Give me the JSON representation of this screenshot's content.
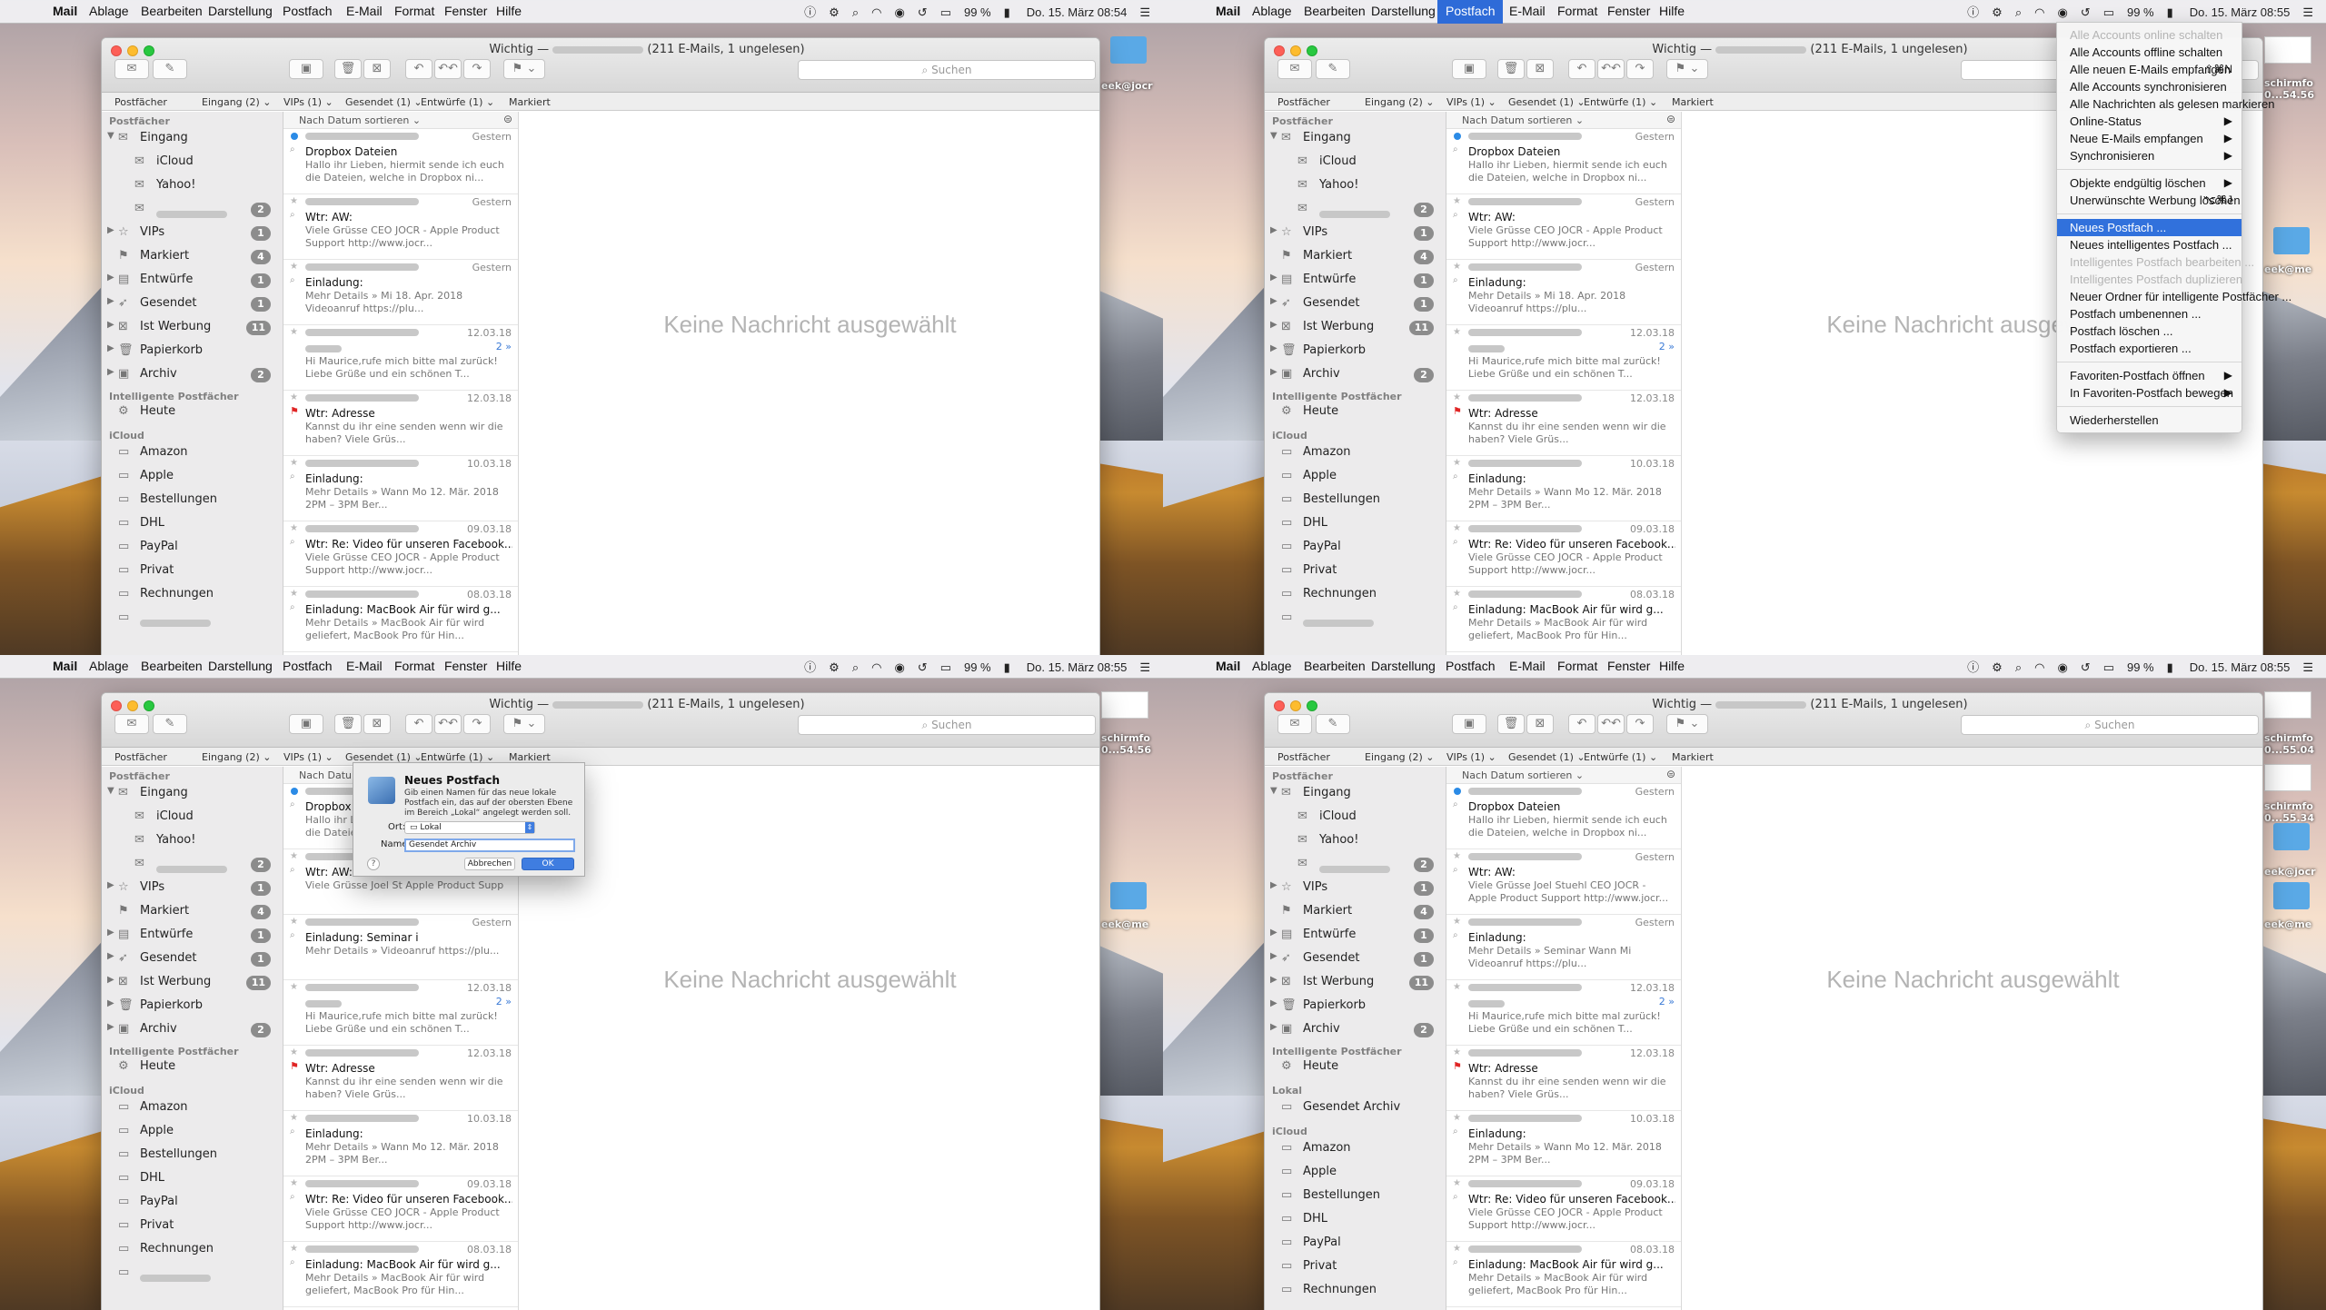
{
  "menubar": {
    "apple": "",
    "items": [
      "Mail",
      "Ablage",
      "Bearbeiten",
      "Darstellung",
      "Postfach",
      "E-Mail",
      "Format",
      "Fenster",
      "Hilfe"
    ],
    "battery": "99 %",
    "times": [
      "Do. 15. März 08:54",
      "Do. 15. März 08:55",
      "Do. 15. März 08:55",
      "Do. 15. März 08:55"
    ]
  },
  "window": {
    "title_prefix": "Wichtig —",
    "title_suffix": "(211 E-Mails, 1 ungelesen)",
    "search_placeholder": "Suchen"
  },
  "favorites": [
    "Postfächer",
    "Eingang (2) ⌄",
    "VIPs (1) ⌄",
    "Gesendet (1) ⌄",
    "Entwürfe (1) ⌄",
    "Markiert"
  ],
  "sidebar": {
    "header_postfaecher": "Postfächer",
    "header_smart": "Intelligente Postfächer",
    "header_local": "Lokal",
    "header_icloud": "iCloud",
    "inbox": "Eingang",
    "icloud_sub": "iCloud",
    "yahoo_sub": "Yahoo!",
    "inbox_badge": "2",
    "vips": "VIPs",
    "vips_badge": "1",
    "markiert": "Markiert",
    "markiert_badge": "4",
    "entwuerfe": "Entwürfe",
    "entwuerfe_badge": "1",
    "gesendet": "Gesendet",
    "gesendet_badge": "1",
    "werbung": "Ist Werbung",
    "werbung_badge": "11",
    "papierkorb": "Papierkorb",
    "archiv": "Archiv",
    "archiv_badge": "2",
    "heute": "Heute",
    "local_folder": "Gesendet Archiv",
    "icloud_folders": [
      "Amazon",
      "Apple",
      "Bestellungen",
      "DHL",
      "PayPal",
      "Privat",
      "Rechnungen"
    ]
  },
  "maillist": {
    "sort_label": "Nach Datum sortieren ⌄",
    "messages": [
      {
        "date": "Gestern",
        "subject": "Dropbox Dateien",
        "preview": "Hallo ihr Lieben,  hiermit sende ich euch die Dateien, welche in Dropbox ni..."
      },
      {
        "date": "Gestern",
        "subject": "Wtr: AW:",
        "preview": "Viele Grüsse          CEO JOCR - Apple Product Support http://www.jocr..."
      },
      {
        "date": "Gestern",
        "subject": "Einladung:",
        "preview": "Mehr Details »         Mi 18. Apr. 2018 Videoanruf https://plu..."
      },
      {
        "date": "12.03.18",
        "subject": "",
        "preview": "Hi Maurice,rufe mich bitte mal zurück! Liebe Grüße und ein schönen T..."
      },
      {
        "date": "12.03.18",
        "subject": "Wtr: Adresse",
        "preview": "Kannst du ihr eine        senden wenn wir die          haben? Viele Grüs..."
      },
      {
        "date": "10.03.18",
        "subject": "Einladung:",
        "preview": "Mehr Details »         Wann Mo 12. Mär. 2018 2PM – 3PM Ber..."
      },
      {
        "date": "09.03.18",
        "subject": "Wtr: Re: Video für unseren Facebook...",
        "preview": "Viele Grüsse          CEO JOCR - Apple Product Support http://www.jocr..."
      },
      {
        "date": "08.03.18",
        "subject": "Einladung: MacBook Air für      wird g...",
        "preview": "Mehr Details » MacBook Air für     wird geliefert, MacBook Pro für        Hin..."
      }
    ],
    "variant_d": [
      {
        "subject": "Wtr: AW:",
        "preview": "Viele Grüsse Joel Stuehl CEO JOCR - Apple Product Support http://www.jocr..."
      },
      {
        "subject": "Einladung:",
        "preview": "Mehr Details » Seminar          Wann Mi          Videoanruf https://plu..."
      }
    ],
    "variant_c": [
      {
        "subject": "Wtr: AW: Kundenver",
        "preview": "Viele Grüsse Joel St Apple Product Supp"
      },
      {
        "subject": "Einladung: Seminar i",
        "preview": "Mehr Details » Videoanruf https://plu..."
      }
    ],
    "thread_count": "2 »"
  },
  "no_message": "Keine Nachricht ausgewählt",
  "postfach_menu": [
    {
      "label": "Alle Accounts online schalten",
      "disabled": true
    },
    {
      "label": "Alle Accounts offline schalten"
    },
    {
      "label": "Alle neuen E-Mails empfangen",
      "shortcut": "⇧⌘N"
    },
    {
      "label": "Alle Accounts synchronisieren"
    },
    {
      "label": "Alle Nachrichten als gelesen markieren"
    },
    {
      "label": "Online-Status",
      "shortcut": "▶"
    },
    {
      "label": "Neue E-Mails empfangen",
      "shortcut": "▶"
    },
    {
      "label": "Synchronisieren",
      "shortcut": "▶"
    },
    {
      "sep": true
    },
    {
      "label": "Objekte endgültig löschen",
      "shortcut": "▶"
    },
    {
      "label": "Unerwünschte Werbung löschen",
      "shortcut": "⌥⌘J"
    },
    {
      "sep": true
    },
    {
      "label": "Neues Postfach ...",
      "highlight": true
    },
    {
      "label": "Neues intelligentes Postfach ..."
    },
    {
      "label": "Intelligentes Postfach bearbeiten ...",
      "disabled": true
    },
    {
      "label": "Intelligentes Postfach duplizieren",
      "disabled": true
    },
    {
      "label": "Neuer Ordner für intelligente Postfächer ..."
    },
    {
      "label": "Postfach umbenennen ..."
    },
    {
      "label": "Postfach löschen ..."
    },
    {
      "label": "Postfach exportieren ..."
    },
    {
      "sep": true
    },
    {
      "label": "Favoriten-Postfach öffnen",
      "shortcut": "▶"
    },
    {
      "label": "In Favoriten-Postfach bewegen",
      "shortcut": "▶"
    },
    {
      "sep": true
    },
    {
      "label": "Wiederherstellen"
    }
  ],
  "dialog": {
    "title": "Neues Postfach",
    "description": "Gib einen Namen für das neue lokale Postfach ein, das auf der obersten Ebene im Bereich „Lokal“ angelegt werden soll.",
    "location_label": "Ort:",
    "location_value": "Lokal",
    "name_label": "Name:",
    "name_value": "Gesendet Archiv",
    "cancel": "Abbrechen",
    "ok": "OK",
    "help": "?"
  },
  "desktop": {
    "labels_a": [
      "eek@jocr"
    ],
    "labels_b": [
      "schirmfo",
      "0...54.56",
      "eek@me"
    ],
    "labels_d": [
      "schirmfo",
      "0...55.04",
      "schirmfo",
      "0...55.34",
      "eek@jocr",
      "eek@me"
    ]
  },
  "colors": {
    "accent": "#2e6bd8",
    "badge": "#8c8c8c",
    "flag": "#e02424",
    "unread": "#2b8be6"
  }
}
